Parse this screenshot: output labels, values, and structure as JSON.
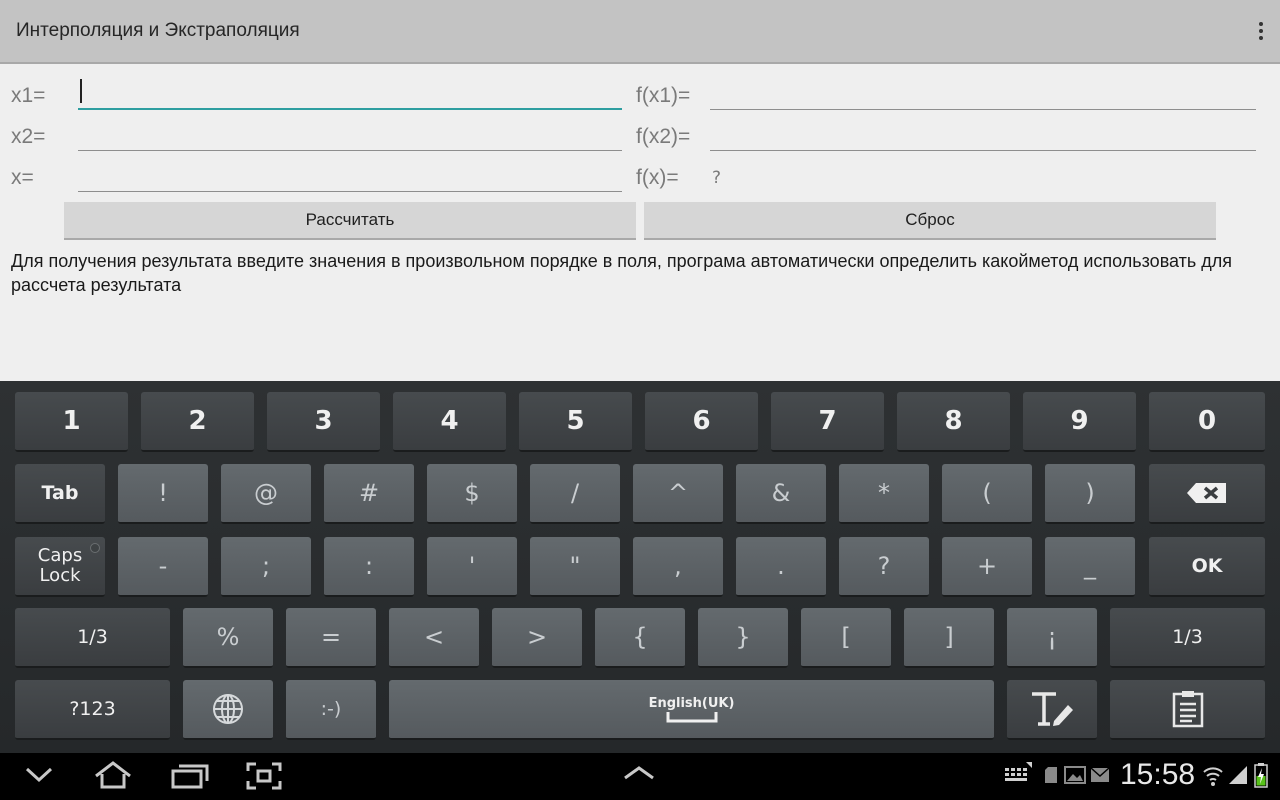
{
  "app": {
    "title": "Интерполяция и Экстраполяция"
  },
  "form": {
    "x1_label": "x1=",
    "x2_label": "x2=",
    "x_label": "x=",
    "fx1_label": "f(x1)=",
    "fx2_label": "f(x2)=",
    "fx_label": "f(x)=",
    "x1_value": "",
    "x2_value": "",
    "x_value": "",
    "fx1_value": "",
    "fx2_value": "",
    "fx_result": "?"
  },
  "buttons": {
    "calculate": "Рассчитать",
    "reset": "Сброс"
  },
  "hint": "Для получения результата введите значения в произвольном порядке в поля, програма автоматически определить какойметод использовать для рассчета результата",
  "keyboard": {
    "row1": [
      "1",
      "2",
      "3",
      "4",
      "5",
      "6",
      "7",
      "8",
      "9",
      "0"
    ],
    "row2": [
      "!",
      "@",
      "#",
      "$",
      "/",
      "^",
      "&",
      "*",
      "(",
      ")"
    ],
    "row3": [
      "-",
      ";",
      ":",
      "'",
      "\"",
      ",",
      ".",
      "?",
      "+",
      "_"
    ],
    "row4": [
      "%",
      "=",
      "<",
      ">",
      "{",
      "}",
      "[",
      "]",
      "¡"
    ],
    "tab": "Tab",
    "caps1": "Caps",
    "caps2": "Lock",
    "ok": "OK",
    "page_left": "1/3",
    "page_right": "1/3",
    "mode": "?123",
    "smiley": ":-)",
    "space_label": "English(UK)"
  },
  "status": {
    "time": "15:58"
  },
  "colors": {
    "accent": "#2e9ea0",
    "actionbar": "#c3c3c3"
  }
}
